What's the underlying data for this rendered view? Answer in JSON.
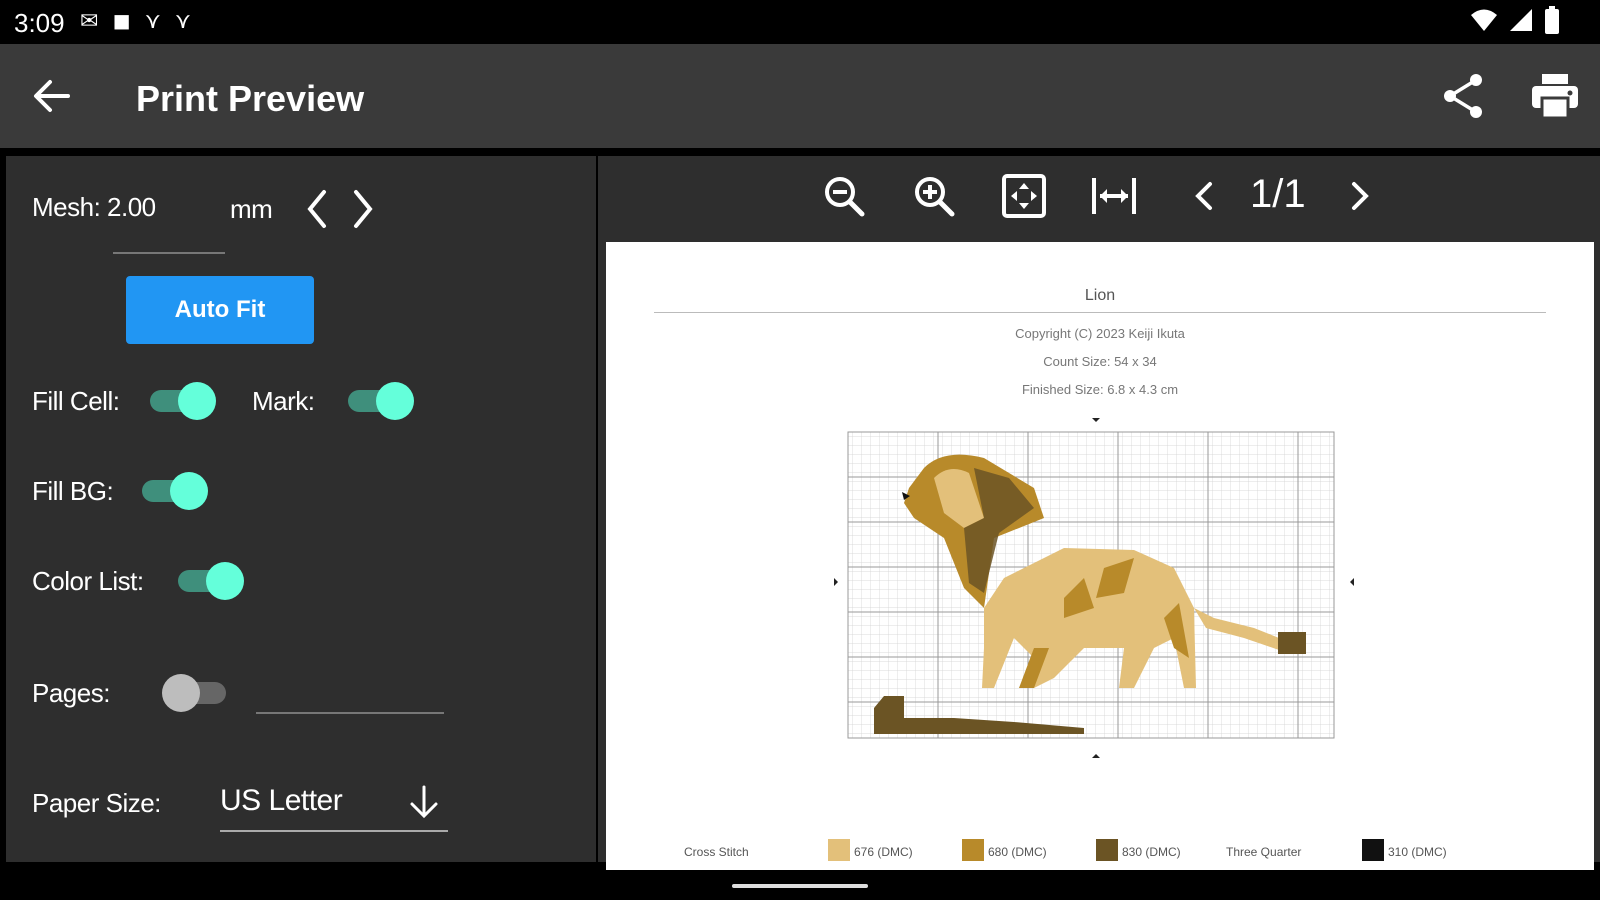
{
  "status": {
    "time": "3:09",
    "notification_icons": [
      "mail-icon",
      "a-icon",
      "network-icon",
      "network-icon"
    ],
    "right_icons": [
      "wifi-icon",
      "signal-icon",
      "battery-icon"
    ]
  },
  "appbar": {
    "title": "Print Preview",
    "actions": [
      "share-icon",
      "print-icon"
    ]
  },
  "settings": {
    "mesh_label": "Mesh: 2.00",
    "mesh_unit": "mm",
    "auto_fit": "Auto Fit",
    "fill_cell_label": "Fill Cell:",
    "fill_cell_on": true,
    "mark_label": "Mark:",
    "mark_on": true,
    "fill_bg_label": "Fill BG:",
    "fill_bg_on": true,
    "color_list_label": "Color List:",
    "color_list_on": true,
    "pages_label": "Pages:",
    "pages_on": false,
    "paper_size_label": "Paper Size:",
    "paper_size_value": "US Letter"
  },
  "viewer": {
    "page_indicator": "1/1",
    "toolbar_icons": [
      "zoom-out-icon",
      "zoom-in-icon",
      "fit-page-icon",
      "fit-width-icon",
      "chevron-left-icon",
      "chevron-right-icon"
    ]
  },
  "document": {
    "title": "Lion",
    "copyright": "Copyright (C) 2023 Keiji Ikuta",
    "count_size": "Count Size: 54 x 34",
    "finished_size": "Finished Size: 6.8 x 4.3 cm",
    "legend": {
      "cross_stitch": "Cross Stitch",
      "three_quarter": "Three Quarter",
      "items": [
        {
          "label": "676 (DMC)",
          "color": "#e3c07a"
        },
        {
          "label": "680 (DMC)",
          "color": "#b88a2a"
        },
        {
          "label": "830 (DMC)",
          "color": "#6b5424"
        },
        {
          "label": "310 (DMC)",
          "color": "#111111"
        }
      ]
    }
  },
  "colors": {
    "appbar": "#3a3a3a",
    "panel": "#2e2e2e",
    "accent": "#2196f3",
    "toggle_on": "#64ffda"
  }
}
